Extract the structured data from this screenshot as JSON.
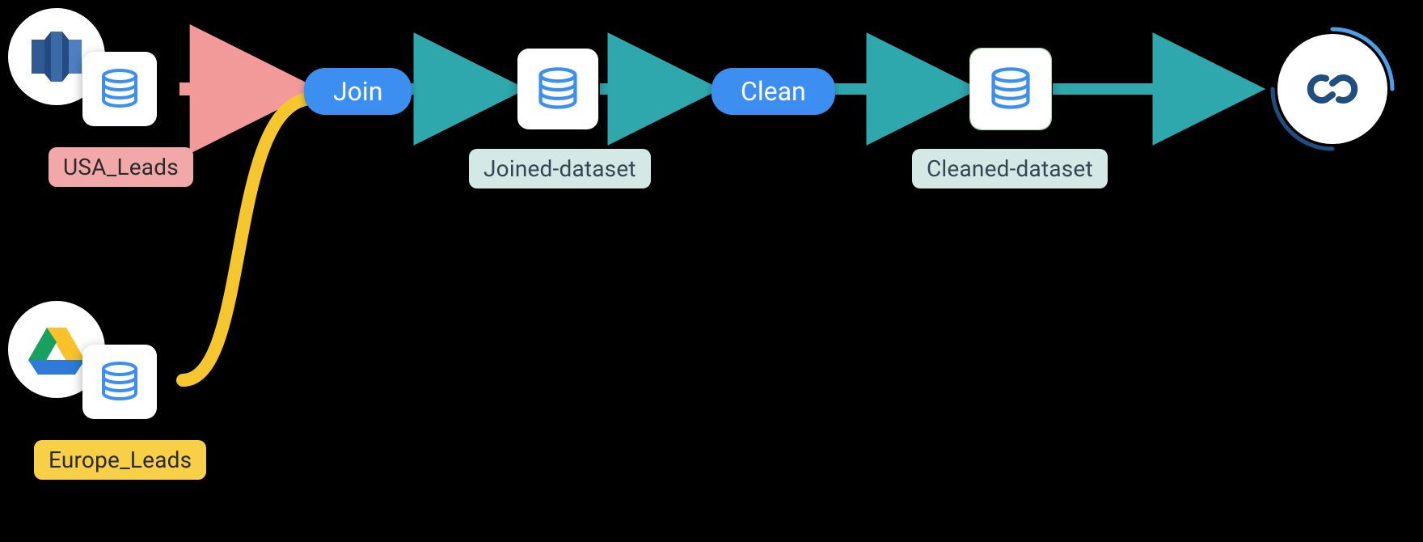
{
  "diagram": {
    "sources": [
      {
        "id": "usa",
        "label": "USA_Leads",
        "connector": "redshift",
        "connector_name": "Amazon Redshift"
      },
      {
        "id": "europe",
        "label": "Europe_Leads",
        "connector": "gdrive",
        "connector_name": "Google Drive"
      }
    ],
    "steps": [
      {
        "type": "transform",
        "label": "Join"
      },
      {
        "type": "dataset",
        "label": "Joined-dataset"
      },
      {
        "type": "transform",
        "label": "Clean"
      },
      {
        "type": "dataset",
        "label": "Cleaned-dataset"
      }
    ],
    "destination": {
      "connector": "zoho",
      "connector_name": "Zoho CRM"
    },
    "colors": {
      "edge_usa": "#f29a9a",
      "edge_europe": "#f6c62e",
      "edge_pipeline": "#2ea7ad",
      "pill": "#3c8ff0",
      "label_usa_bg": "#f2a8a8",
      "label_usa_fg": "#2b2b2b",
      "label_europe_bg": "#f8d047",
      "label_europe_fg": "#2b2b2b",
      "label_dataset_bg": "#d4e8e5",
      "label_dataset_fg": "#334653",
      "db_icon": "#3c8ff0",
      "dest_ring": "#4c9fe8",
      "dest_icon": "#1f4f80"
    }
  }
}
